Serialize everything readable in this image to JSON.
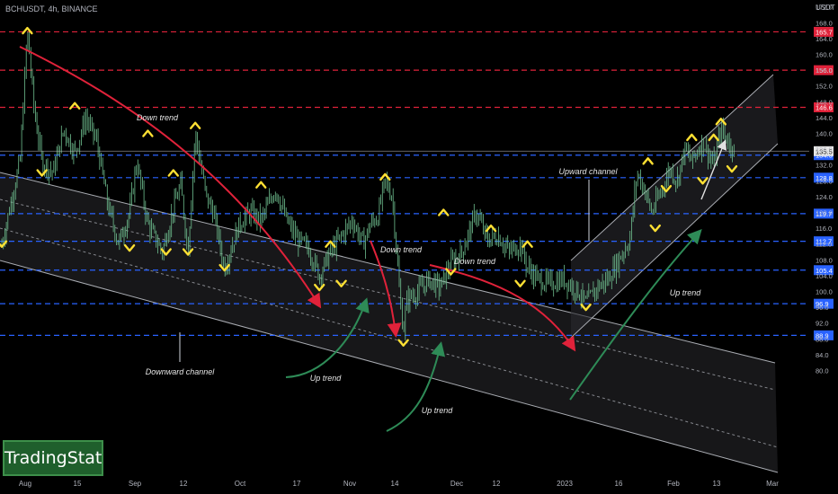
{
  "header": {
    "symbol": "BCHUSDT, 4h, BINANCE",
    "currency": "USDT"
  },
  "brand": {
    "name": "TradingStat"
  },
  "colors": {
    "background": "#000000",
    "candle": "#6fbf8f",
    "red_line": "#e0223a",
    "blue_line": "#2962ff",
    "channel_fill": "#2a2a2e",
    "channel_edge": "#d1d4dc",
    "down_arrow": "#e0223a",
    "up_arrow": "#2e8b57",
    "marker": "#ffe033",
    "axis_text": "#b2b5be",
    "current_price_bg": "#e6e6e6"
  },
  "chart_data": {
    "type": "candlestick",
    "title": "BCHUSDT, 4h, BINANCE",
    "ylim": [
      80,
      175
    ],
    "y_ticks": [
      "80.0",
      "84.0",
      "88.0",
      "92.0",
      "96.0",
      "100.0",
      "104.0",
      "108.0",
      "112.0",
      "116.0",
      "120.0",
      "124.0",
      "128.0",
      "132.0",
      "136.0",
      "140.0",
      "144.0",
      "148.0",
      "152.0",
      "156.0",
      "160.0",
      "164.0",
      "168.0",
      "172.0"
    ],
    "x_ticks": [
      "Aug",
      "15",
      "Sep",
      "12",
      "Oct",
      "17",
      "Nov",
      "14",
      "Dec",
      "12",
      "2023",
      "16",
      "Feb",
      "13",
      "Mar"
    ],
    "price_path": [
      [
        "Jul 23",
        112
      ],
      [
        "Jul 28",
        133
      ],
      [
        "Jul 30",
        166
      ],
      [
        "Aug 1",
        145
      ],
      [
        "Aug 3",
        133
      ],
      [
        "Aug 6",
        130
      ],
      [
        "Aug 9",
        141
      ],
      [
        "Aug 12",
        135
      ],
      [
        "Aug 15",
        144
      ],
      [
        "Aug 18",
        138
      ],
      [
        "Aug 21",
        122
      ],
      [
        "Aug 24",
        112
      ],
      [
        "Aug 27",
        120
      ],
      [
        "Aug 29",
        133
      ],
      [
        "Sep 1",
        117
      ],
      [
        "Sep 5",
        110
      ],
      [
        "Sep 8",
        121
      ],
      [
        "Sep 10",
        127
      ],
      [
        "Sep 12",
        110
      ],
      [
        "Sep 14",
        140
      ],
      [
        "Sep 17",
        124
      ],
      [
        "Sep 19",
        120
      ],
      [
        "Sep 22",
        106
      ],
      [
        "Sep 26",
        117
      ],
      [
        "Sep 29",
        120
      ],
      [
        "Oct 2",
        118
      ],
      [
        "Oct 6",
        126
      ],
      [
        "Oct 9",
        118
      ],
      [
        "Oct 12",
        113
      ],
      [
        "Oct 15",
        111
      ],
      [
        "Oct 18",
        104
      ],
      [
        "Oct 21",
        110
      ],
      [
        "Oct 24",
        114
      ],
      [
        "Oct 27",
        118
      ],
      [
        "Oct 30",
        112
      ],
      [
        "Nov 1",
        117
      ],
      [
        "Nov 3",
        119
      ],
      [
        "Nov 5",
        128
      ],
      [
        "Nov 7",
        124
      ],
      [
        "Nov 8",
        112
      ],
      [
        "Nov 9",
        99
      ],
      [
        "Nov 10",
        90
      ],
      [
        "Nov 11",
        98
      ],
      [
        "Nov 14",
        100
      ],
      [
        "Nov 17",
        103
      ],
      [
        "Nov 20",
        101
      ],
      [
        "Nov 23",
        107
      ],
      [
        "Nov 26",
        110
      ],
      [
        "Nov 30",
        120
      ],
      [
        "Dec 3",
        113
      ],
      [
        "Dec 6",
        114
      ],
      [
        "Dec 9",
        110
      ],
      [
        "Dec 12",
        112
      ],
      [
        "Dec 14",
        106
      ],
      [
        "Dec 17",
        103
      ],
      [
        "Dec 20",
        102
      ],
      [
        "Dec 24",
        103
      ],
      [
        "Dec 28",
        100
      ],
      [
        "Dec 30",
        97
      ],
      [
        "Jan 2",
        101
      ],
      [
        "Jan 5",
        103
      ],
      [
        "Jan 8",
        108
      ],
      [
        "Jan 11",
        113
      ],
      [
        "Jan 13",
        130
      ],
      [
        "Jan 15",
        126
      ],
      [
        "Jan 17",
        120
      ],
      [
        "Jan 19",
        124
      ],
      [
        "Jan 22",
        131
      ],
      [
        "Jan 24",
        128
      ],
      [
        "Jan 26",
        136
      ],
      [
        "Jan 28",
        133
      ],
      [
        "Jan 31",
        138
      ],
      [
        "Feb 3",
        132
      ],
      [
        "Feb 5",
        141
      ],
      [
        "Feb 7",
        138
      ],
      [
        "Feb 9",
        135.5
      ]
    ],
    "horizontal_levels": [
      {
        "price": 165.7,
        "label": "165.7",
        "style": "red-dashed"
      },
      {
        "price": 156.0,
        "label": "156.0",
        "style": "red-dashed"
      },
      {
        "price": 146.6,
        "label": "146.6",
        "style": "red-dashed"
      },
      {
        "price": 134.5,
        "label": "134.5",
        "style": "blue-dashed"
      },
      {
        "price": 128.8,
        "label": "128.8",
        "style": "blue-dashed"
      },
      {
        "price": 119.7,
        "label": "119.7",
        "style": "blue-dashed"
      },
      {
        "price": 112.7,
        "label": "112.7",
        "style": "blue-dashed"
      },
      {
        "price": 105.4,
        "label": "105.4",
        "style": "blue-dashed"
      },
      {
        "price": 96.9,
        "label": "96.9",
        "style": "blue-dashed"
      },
      {
        "price": 88.9,
        "label": "88.9",
        "style": "blue-dashed"
      }
    ],
    "current_price": {
      "price": 135.5,
      "label": "135.5"
    },
    "annotations": [
      {
        "text": "Down trend",
        "kind": "down"
      },
      {
        "text": "Down trend",
        "kind": "down"
      },
      {
        "text": "Down trend",
        "kind": "down"
      },
      {
        "text": "Up trend",
        "kind": "up"
      },
      {
        "text": "Up trend",
        "kind": "up"
      },
      {
        "text": "Up trend",
        "kind": "up"
      },
      {
        "text": "Downward channel",
        "kind": "label"
      },
      {
        "text": "Upward channel",
        "kind": "label"
      }
    ],
    "pivot_markers": [
      {
        "date": "Jul 23",
        "price": 112,
        "dir": "down"
      },
      {
        "date": "Jul 30",
        "price": 166,
        "dir": "up"
      },
      {
        "date": "Aug 3",
        "price": 130,
        "dir": "down"
      },
      {
        "date": "Aug 12",
        "price": 147,
        "dir": "up"
      },
      {
        "date": "Aug 27",
        "price": 111,
        "dir": "down"
      },
      {
        "date": "Sep 1",
        "price": 140,
        "dir": "up"
      },
      {
        "date": "Sep 6",
        "price": 110,
        "dir": "down"
      },
      {
        "date": "Sep 8",
        "price": 130,
        "dir": "up"
      },
      {
        "date": "Sep 12",
        "price": 110,
        "dir": "down"
      },
      {
        "date": "Sep 14",
        "price": 142,
        "dir": "up"
      },
      {
        "date": "Sep 22",
        "price": 106,
        "dir": "down"
      },
      {
        "date": "Oct 2",
        "price": 127,
        "dir": "up"
      },
      {
        "date": "Oct 18",
        "price": 101,
        "dir": "down"
      },
      {
        "date": "Oct 21",
        "price": 112,
        "dir": "up"
      },
      {
        "date": "Oct 24",
        "price": 102,
        "dir": "down"
      },
      {
        "date": "Nov 5",
        "price": 129,
        "dir": "up"
      },
      {
        "date": "Nov 10",
        "price": 87,
        "dir": "down"
      },
      {
        "date": "Nov 21",
        "price": 120,
        "dir": "up"
      },
      {
        "date": "Nov 23",
        "price": 105,
        "dir": "down"
      },
      {
        "date": "Dec 4",
        "price": 116,
        "dir": "up"
      },
      {
        "date": "Dec 12",
        "price": 102,
        "dir": "down"
      },
      {
        "date": "Dec 14",
        "price": 112,
        "dir": "up"
      },
      {
        "date": "Dec 30",
        "price": 96,
        "dir": "down"
      },
      {
        "date": "Jan 16",
        "price": 133,
        "dir": "up"
      },
      {
        "date": "Jan 18",
        "price": 116,
        "dir": "down"
      },
      {
        "date": "Jan 21",
        "price": 126,
        "dir": "down"
      },
      {
        "date": "Jan 28",
        "price": 139,
        "dir": "up"
      },
      {
        "date": "Jan 31",
        "price": 128,
        "dir": "down"
      },
      {
        "date": "Feb 3",
        "price": 139,
        "dir": "up"
      },
      {
        "date": "Feb 5",
        "price": 143,
        "dir": "up"
      },
      {
        "date": "Feb 8",
        "price": 131,
        "dir": "down"
      }
    ],
    "grid": false,
    "legend": "none"
  }
}
